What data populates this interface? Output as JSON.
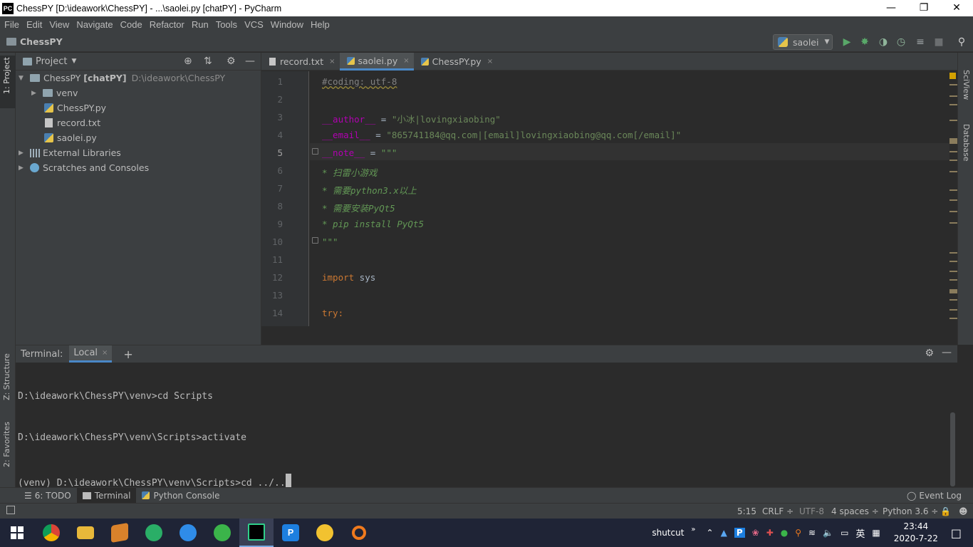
{
  "window": {
    "title": "ChessPY [D:\\ideawork\\ChessPY] - ...\\saolei.py [chatPY] - PyCharm",
    "app_icon": "PC"
  },
  "menu": [
    "File",
    "Edit",
    "View",
    "Navigate",
    "Code",
    "Refactor",
    "Run",
    "Tools",
    "VCS",
    "Window",
    "Help"
  ],
  "navbar": {
    "project": "ChessPY",
    "run_config": "saolei"
  },
  "left_strip": {
    "project": "1: Project",
    "structure": "Z: Structure",
    "favorites": "2: Favorites"
  },
  "right_strip": {
    "sciview": "SciView",
    "database": "Database"
  },
  "project_panel": {
    "title": "Project",
    "tree": [
      {
        "label": "ChessPY",
        "suffix": "[chatPY]",
        "path": "D:\\ideawork\\ChessPY"
      },
      {
        "label": "venv"
      },
      {
        "label": "ChessPY.py"
      },
      {
        "label": "record.txt"
      },
      {
        "label": "saolei.py"
      },
      {
        "label": "External Libraries"
      },
      {
        "label": "Scratches and Consoles"
      }
    ]
  },
  "tabs": [
    {
      "label": "record.txt",
      "close": "×"
    },
    {
      "label": "saolei.py",
      "close": "×"
    },
    {
      "label": "ChessPY.py",
      "close": "×"
    }
  ],
  "line_numbers": [
    "1",
    "2",
    "3",
    "4",
    "5",
    "6",
    "7",
    "8",
    "9",
    "10",
    "11",
    "12",
    "13",
    "14"
  ],
  "code": {
    "l1": "#coding: utf-8",
    "l3a": "__author__",
    "l3b": " = ",
    "l3c": "\"小冰|lovingxiaobing\"",
    "l4a": "__email__",
    "l4b": " = ",
    "l4c": "\"865741184@qq.com|[email]lovingxiaobing@qq.com[/email]\"",
    "l5a": "__note__",
    "l5b": " = ",
    "l5c": "\"\"\"",
    "l6": "* 扫雷小游戏",
    "l7": "* 需要python3.x以上",
    "l8": "* 需要安装PyQt5",
    "l9": "* pip install PyQt5",
    "l10": "\"\"\"",
    "l12a": "import",
    "l12b": " sys",
    "l14a": "try",
    "l14b": ":"
  },
  "terminal": {
    "label": "Terminal:",
    "tab": "Local",
    "close": "×",
    "add": "+",
    "lines": [
      "D:\\ideawork\\ChessPY\\venv>cd Scripts",
      "D:\\ideawork\\ChessPY\\venv\\Scripts>activate",
      "(venv) D:\\ideawork\\ChessPY\\venv\\Scripts>cd ../.."
    ]
  },
  "bottom_tools": {
    "todo": "6: TODO",
    "terminal": "Terminal",
    "python_console": "Python Console",
    "event_log": "Event Log"
  },
  "status": {
    "position": "5:15",
    "line_sep": "CRLF ÷",
    "encoding": "UTF-8",
    "indent": "4 spaces ÷",
    "interpreter": "Python 3.6 ÷"
  },
  "taskbar": {
    "tray_label": "shutcut",
    "ime": "英",
    "time": "23:44",
    "date": "2020-7-22"
  },
  "colors": {
    "accent": "#4a88c7",
    "keyword": "#cc7832",
    "string": "#6a8759",
    "dunder": "#b200b2",
    "docstring": "#629755",
    "comment": "#808080"
  }
}
